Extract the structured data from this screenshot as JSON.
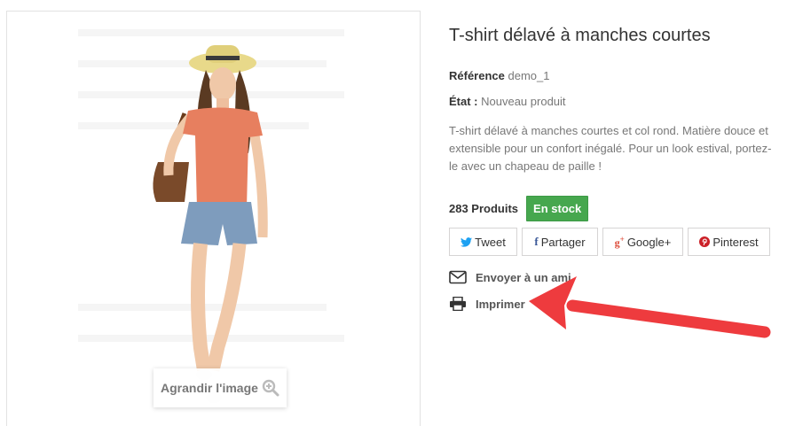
{
  "product": {
    "title": "T-shirt délavé à manches courtes",
    "reference_label": "Référence",
    "reference_value": "demo_1",
    "condition_label": "État :",
    "condition_value": "Nouveau produit",
    "description": "T-shirt délavé à manches courtes et col rond. Matière douce et extensible pour un confort inégalé. Pour un look estival, portez-le avec un chapeau de paille !",
    "quantity_label": "283 Produits",
    "stock_badge": "En stock"
  },
  "image": {
    "zoom_label": "Agrandir l'image"
  },
  "share": {
    "tweet": "Tweet",
    "partager": "Partager",
    "googleplus": "Google+",
    "pinterest": "Pinterest"
  },
  "actions": {
    "send_friend": "Envoyer à un ami",
    "print": "Imprimer"
  },
  "colors": {
    "stock_green": "#46a74e",
    "twitter_blue": "#1da1f2",
    "facebook_blue": "#3b5998",
    "google_red": "#dd4b39",
    "pinterest_red": "#cb2027",
    "annotation_red": "#ee3b3e"
  }
}
